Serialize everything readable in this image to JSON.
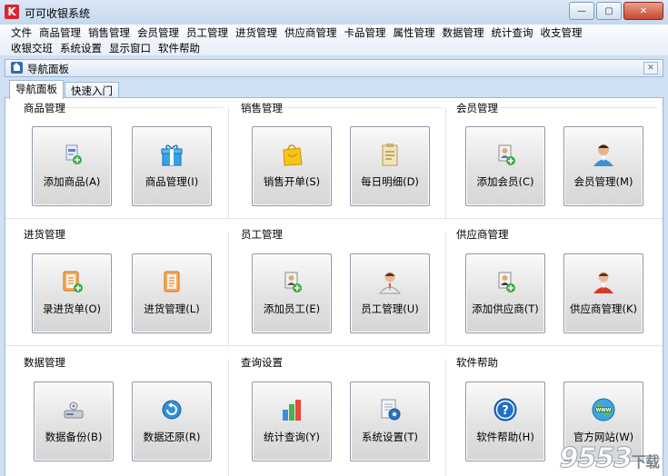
{
  "window": {
    "title": "可可收银系统",
    "logo_letter": "K",
    "minimize": "—",
    "maximize": "▢",
    "close": "✕"
  },
  "menu": {
    "row1": [
      "文件",
      "商品管理",
      "销售管理",
      "会员管理",
      "员工管理",
      "进货管理",
      "供应商管理",
      "卡品管理",
      "属性管理",
      "数据管理",
      "统计查询",
      "收支管理"
    ],
    "row2": [
      "收银交班",
      "系统设置",
      "显示窗口",
      "软件帮助"
    ]
  },
  "panel": {
    "title": "导航面板",
    "close": "✕",
    "tabs": [
      "导航面板",
      "快速入门"
    ]
  },
  "groups": {
    "goods": {
      "title": "商品管理",
      "b1": "添加商品(A)",
      "b2": "商品管理(I)"
    },
    "sales": {
      "title": "销售管理",
      "b1": "销售开单(S)",
      "b2": "每日明细(D)"
    },
    "member": {
      "title": "会员管理",
      "b1": "添加会员(C)",
      "b2": "会员管理(M)"
    },
    "purchase": {
      "title": "进货管理",
      "b1": "录进货单(O)",
      "b2": "进货管理(L)"
    },
    "staff": {
      "title": "员工管理",
      "b1": "添加员工(E)",
      "b2": "员工管理(U)"
    },
    "supplier": {
      "title": "供应商管理",
      "b1": "添加供应商(T)",
      "b2": "供应商管理(K)"
    },
    "data": {
      "title": "数据管理",
      "b1": "数据备份(B)",
      "b2": "数据还原(R)"
    },
    "query": {
      "title": "查询设置",
      "b1": "统计查询(Y)",
      "b2": "系统设置(T)"
    },
    "help": {
      "title": "软件帮助",
      "b1": "软件帮助(H)",
      "b2": "官方网站(W)"
    }
  },
  "watermark": {
    "text": "9553",
    "sub": "下载"
  },
  "icons": {
    "add_goods": "add-goods-icon",
    "goods": "gift-icon",
    "sale": "shopping-bag-icon",
    "daily": "clipboard-icon",
    "add_member": "add-member-icon",
    "member": "person-icon",
    "add_order": "add-document-icon",
    "purchase": "document-icon",
    "add_staff": "add-staff-icon",
    "staff": "businessman-icon",
    "add_supplier": "add-supplier-icon",
    "supplier": "supplier-person-icon",
    "backup": "database-icon",
    "restore": "restore-icon",
    "stats": "bar-chart-icon",
    "settings": "settings-document-icon",
    "help": "question-icon",
    "website": "globe-icon"
  }
}
